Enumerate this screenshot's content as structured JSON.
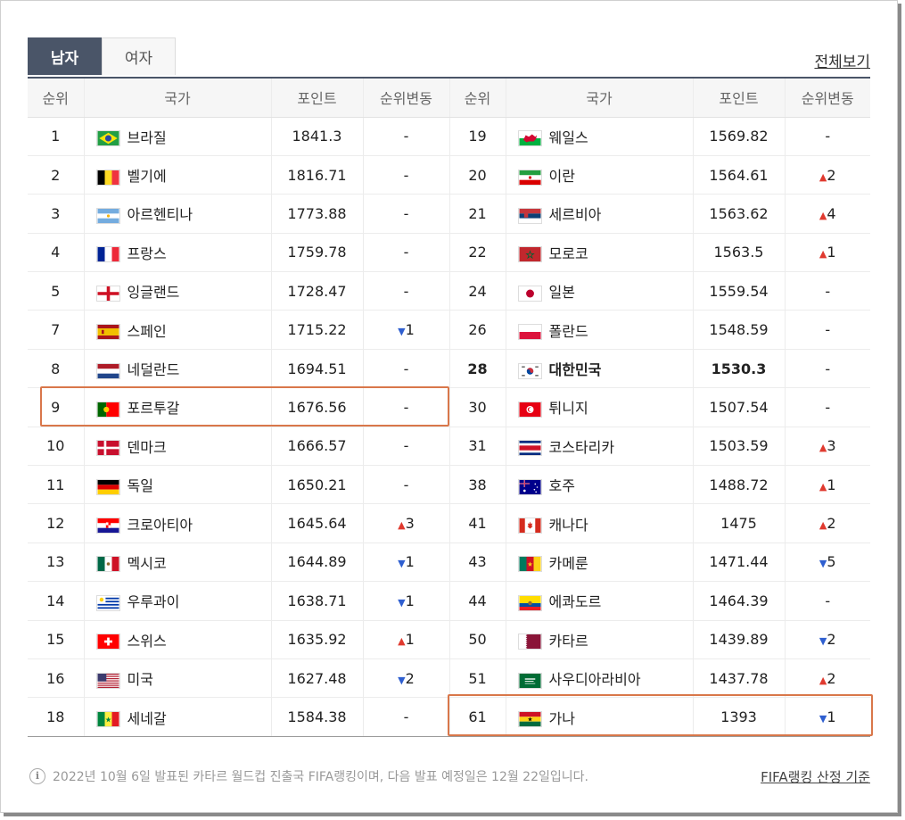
{
  "tabs": [
    {
      "label": "남자",
      "active": true
    },
    {
      "label": "여자",
      "active": false
    }
  ],
  "view_all": "전체보기",
  "headers": [
    "순위",
    "국가",
    "포인트",
    "순위변동",
    "순위",
    "국가",
    "포인트",
    "순위변동"
  ],
  "left": [
    {
      "rank": "1",
      "country": "브라질",
      "flag": "brazil",
      "points": "1841.3",
      "change": "-"
    },
    {
      "rank": "2",
      "country": "벨기에",
      "flag": "belgium",
      "points": "1816.71",
      "change": "-"
    },
    {
      "rank": "3",
      "country": "아르헨티나",
      "flag": "argentina",
      "points": "1773.88",
      "change": "-"
    },
    {
      "rank": "4",
      "country": "프랑스",
      "flag": "france",
      "points": "1759.78",
      "change": "-"
    },
    {
      "rank": "5",
      "country": "잉글랜드",
      "flag": "england",
      "points": "1728.47",
      "change": "-"
    },
    {
      "rank": "7",
      "country": "스페인",
      "flag": "spain",
      "points": "1715.22",
      "change": "1",
      "dir": "down"
    },
    {
      "rank": "8",
      "country": "네덜란드",
      "flag": "netherlands",
      "points": "1694.51",
      "change": "-"
    },
    {
      "rank": "9",
      "country": "포르투갈",
      "flag": "portugal",
      "points": "1676.56",
      "change": "-"
    },
    {
      "rank": "10",
      "country": "덴마크",
      "flag": "denmark",
      "points": "1666.57",
      "change": "-"
    },
    {
      "rank": "11",
      "country": "독일",
      "flag": "germany",
      "points": "1650.21",
      "change": "-"
    },
    {
      "rank": "12",
      "country": "크로아티아",
      "flag": "croatia",
      "points": "1645.64",
      "change": "3",
      "dir": "up"
    },
    {
      "rank": "13",
      "country": "멕시코",
      "flag": "mexico",
      "points": "1644.89",
      "change": "1",
      "dir": "down"
    },
    {
      "rank": "14",
      "country": "우루과이",
      "flag": "uruguay",
      "points": "1638.71",
      "change": "1",
      "dir": "down"
    },
    {
      "rank": "15",
      "country": "스위스",
      "flag": "switzerland",
      "points": "1635.92",
      "change": "1",
      "dir": "up"
    },
    {
      "rank": "16",
      "country": "미국",
      "flag": "usa",
      "points": "1627.48",
      "change": "2",
      "dir": "down"
    },
    {
      "rank": "18",
      "country": "세네갈",
      "flag": "senegal",
      "points": "1584.38",
      "change": "-"
    }
  ],
  "right": [
    {
      "rank": "19",
      "country": "웨일스",
      "flag": "wales",
      "points": "1569.82",
      "change": "-"
    },
    {
      "rank": "20",
      "country": "이란",
      "flag": "iran",
      "points": "1564.61",
      "change": "2",
      "dir": "up"
    },
    {
      "rank": "21",
      "country": "세르비아",
      "flag": "serbia",
      "points": "1563.62",
      "change": "4",
      "dir": "up"
    },
    {
      "rank": "22",
      "country": "모로코",
      "flag": "morocco",
      "points": "1563.5",
      "change": "1",
      "dir": "up"
    },
    {
      "rank": "24",
      "country": "일본",
      "flag": "japan",
      "points": "1559.54",
      "change": "-"
    },
    {
      "rank": "26",
      "country": "폴란드",
      "flag": "poland",
      "points": "1548.59",
      "change": "-"
    },
    {
      "rank": "28",
      "country": "대한민국",
      "flag": "korea",
      "points": "1530.3",
      "change": "-",
      "bold": true
    },
    {
      "rank": "30",
      "country": "튀니지",
      "flag": "tunisia",
      "points": "1507.54",
      "change": "-"
    },
    {
      "rank": "31",
      "country": "코스타리카",
      "flag": "costarica",
      "points": "1503.59",
      "change": "3",
      "dir": "up"
    },
    {
      "rank": "38",
      "country": "호주",
      "flag": "australia",
      "points": "1488.72",
      "change": "1",
      "dir": "up"
    },
    {
      "rank": "41",
      "country": "캐나다",
      "flag": "canada",
      "points": "1475",
      "change": "2",
      "dir": "up"
    },
    {
      "rank": "43",
      "country": "카메룬",
      "flag": "cameroon",
      "points": "1471.44",
      "change": "5",
      "dir": "down"
    },
    {
      "rank": "44",
      "country": "에콰도르",
      "flag": "ecuador",
      "points": "1464.39",
      "change": "-"
    },
    {
      "rank": "50",
      "country": "카타르",
      "flag": "qatar",
      "points": "1439.89",
      "change": "2",
      "dir": "down"
    },
    {
      "rank": "51",
      "country": "사우디아라비아",
      "flag": "saudi",
      "points": "1437.78",
      "change": "2",
      "dir": "up"
    },
    {
      "rank": "61",
      "country": "가나",
      "flag": "ghana",
      "points": "1393",
      "change": "1",
      "dir": "down"
    }
  ],
  "colors": {
    "accent": "#4a5568",
    "up": "#e03a2f",
    "down": "#2f5fd0",
    "highlight": "#d9774a"
  },
  "footer": {
    "note": "2022년 10월 6일 발표된 카타르 월드컵 진출국 FIFA랭킹이며, 다음 발표 예정일은 12월 22일입니다.",
    "link": "FIFA랭킹 산정 기준"
  }
}
